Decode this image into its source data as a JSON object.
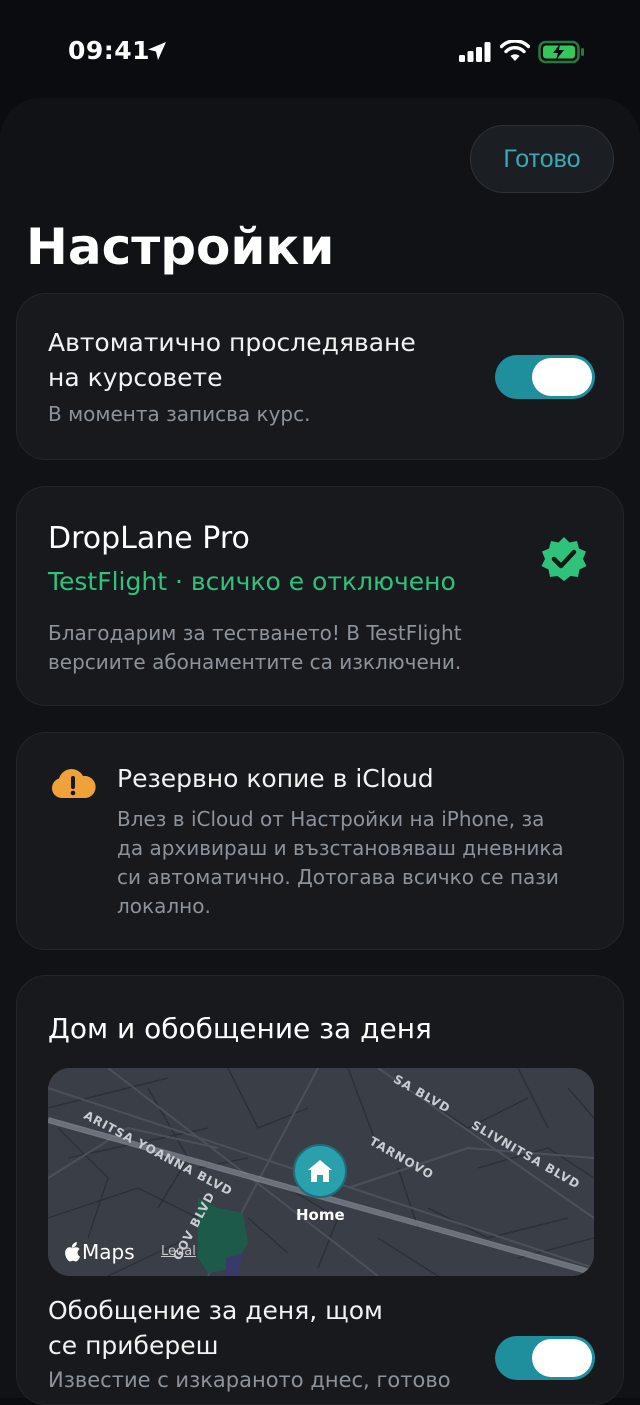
{
  "status_bar": {
    "time": "09:41",
    "icons": [
      "location-arrow-icon",
      "cellular-signal-icon",
      "wifi-icon",
      "battery-charging-icon"
    ],
    "battery_color": "#35c759"
  },
  "header": {
    "done_label": "Готово",
    "title": "Настройки"
  },
  "auto_tracking": {
    "label": "Автоматично проследяване на курсовете",
    "label_line1": "Автоматично проследяване",
    "label_line2": "на курсовете",
    "subtitle": "В момента записва курс.",
    "enabled": true
  },
  "pro": {
    "title": "DropLane Pro",
    "status": "TestFlight · всичко е отключено",
    "description_line1": "Благодарим за тестването! В TestFlight",
    "description_line2": "версиите абонаментите са изключени.",
    "badge_icon": "verified-check-badge-icon",
    "status_color": "#2ec27a"
  },
  "icloud": {
    "icon": "cloud-warning-icon",
    "title": "Резервно копие в iCloud",
    "text_line1": "Влез в iCloud от Настройки на iPhone, за",
    "text_line2": "да архивираш и възстановяваш дневника",
    "text_line3": "си автоматично. Дотогава всичко се пази",
    "text_line4": "локално.",
    "icon_color": "#f0a23a"
  },
  "home_summary": {
    "title": "Дом и обобщение за деня",
    "map": {
      "pin_label": "Home",
      "maps_label": "Maps",
      "legal_label": "Legal",
      "streets": [
        "ARITSA YOANNA BLVD",
        "SA BLVD",
        "TARNOVO",
        "SLIVNITSA BLVD",
        "GOV BLVD"
      ]
    },
    "summary_label_line1": "Обобщение за деня, щом",
    "summary_label_line2": "се прибереш",
    "summary_subtitle": "Известие с изкараното днес, готово",
    "summary_enabled": true
  },
  "accent_color": "#1f8e9d"
}
